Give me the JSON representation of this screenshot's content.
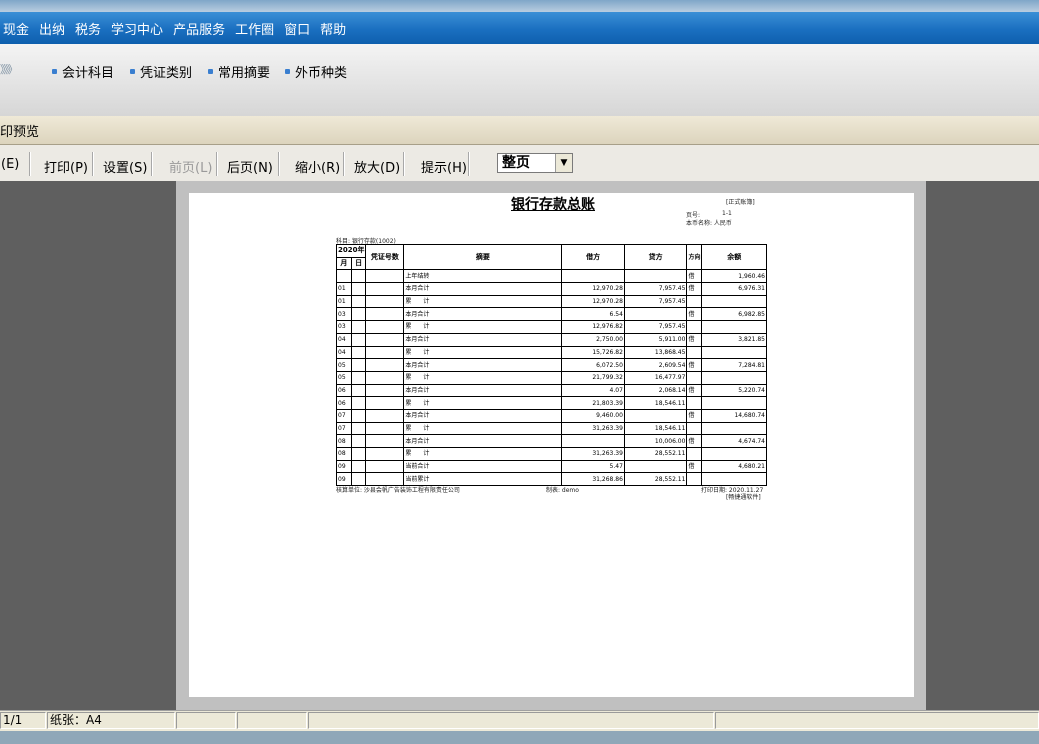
{
  "menu": [
    "现金",
    "出纳",
    "税务",
    "学习中心",
    "产品服务",
    "工作圈",
    "窗口",
    "帮助"
  ],
  "nav": {
    "chevron": "》》》",
    "links": [
      "会计科目",
      "凭证类别",
      "常用摘要",
      "外币种类"
    ]
  },
  "window_title": "印预览",
  "toolbar": {
    "edit": "(E)",
    "print": "打印(P)",
    "setup": "设置(S)",
    "prev": "前页(L)",
    "next": "后页(N)",
    "zoom_out": "缩小(R)",
    "zoom_in": "放大(D)",
    "hint": "提示(H)",
    "zoom_value": "整页"
  },
  "report": {
    "title": "银行存款总账",
    "tag": "[正式账簿]",
    "page_no_label": "页号:",
    "page_no": "1-1",
    "currency": "本币名称: 人民币",
    "subject": "科目: 银行存款(1002)",
    "headers": {
      "year": "2020年",
      "month": "月",
      "day": "日",
      "voucher": "凭证号数",
      "summary": "摘要",
      "debit": "借方",
      "credit": "贷方",
      "direction": "方向",
      "balance": "余额"
    },
    "rows": [
      {
        "m": "",
        "d": "",
        "v": "",
        "s": "上年结转",
        "dr": "",
        "cr": "",
        "dir": "借",
        "bal": "1,960.46"
      },
      {
        "m": "01",
        "d": "",
        "v": "",
        "s": "本月合计",
        "dr": "12,970.28",
        "cr": "7,957.45",
        "dir": "借",
        "bal": "6,976.31"
      },
      {
        "m": "01",
        "d": "",
        "v": "",
        "s": "累　　计",
        "dr": "12,970.28",
        "cr": "7,957.45",
        "dir": "",
        "bal": ""
      },
      {
        "m": "03",
        "d": "",
        "v": "",
        "s": "本月合计",
        "dr": "6.54",
        "cr": "",
        "dir": "借",
        "bal": "6,982.85"
      },
      {
        "m": "03",
        "d": "",
        "v": "",
        "s": "累　　计",
        "dr": "12,976.82",
        "cr": "7,957.45",
        "dir": "",
        "bal": ""
      },
      {
        "m": "04",
        "d": "",
        "v": "",
        "s": "本月合计",
        "dr": "2,750.00",
        "cr": "5,911.00",
        "dir": "借",
        "bal": "3,821.85"
      },
      {
        "m": "04",
        "d": "",
        "v": "",
        "s": "累　　计",
        "dr": "15,726.82",
        "cr": "13,868.45",
        "dir": "",
        "bal": ""
      },
      {
        "m": "05",
        "d": "",
        "v": "",
        "s": "本月合计",
        "dr": "6,072.50",
        "cr": "2,609.54",
        "dir": "借",
        "bal": "7,284.81"
      },
      {
        "m": "05",
        "d": "",
        "v": "",
        "s": "累　　计",
        "dr": "21,799.32",
        "cr": "16,477.97",
        "dir": "",
        "bal": ""
      },
      {
        "m": "06",
        "d": "",
        "v": "",
        "s": "本月合计",
        "dr": "4.07",
        "cr": "2,068.14",
        "dir": "借",
        "bal": "5,220.74"
      },
      {
        "m": "06",
        "d": "",
        "v": "",
        "s": "累　　计",
        "dr": "21,803.39",
        "cr": "18,546.11",
        "dir": "",
        "bal": ""
      },
      {
        "m": "07",
        "d": "",
        "v": "",
        "s": "本月合计",
        "dr": "9,460.00",
        "cr": "",
        "dir": "借",
        "bal": "14,680.74"
      },
      {
        "m": "07",
        "d": "",
        "v": "",
        "s": "累　　计",
        "dr": "31,263.39",
        "cr": "18,546.11",
        "dir": "",
        "bal": ""
      },
      {
        "m": "08",
        "d": "",
        "v": "",
        "s": "本月合计",
        "dr": "",
        "cr": "10,006.00",
        "dir": "借",
        "bal": "4,674.74"
      },
      {
        "m": "08",
        "d": "",
        "v": "",
        "s": "累　　计",
        "dr": "31,263.39",
        "cr": "28,552.11",
        "dir": "",
        "bal": ""
      },
      {
        "m": "09",
        "d": "",
        "v": "",
        "s": "当前合计",
        "dr": "5.47",
        "cr": "",
        "dir": "借",
        "bal": "4,680.21"
      },
      {
        "m": "09",
        "d": "",
        "v": "",
        "s": "当前累计",
        "dr": "31,268.86",
        "cr": "28,552.11",
        "dir": "",
        "bal": ""
      }
    ],
    "footer_unit": "核算单位: 沙县会帆广告装饰工程有限责任公司",
    "footer_maker": "制表: demo",
    "footer_date": "打印日期: 2020.11.27",
    "footer_brand": "[畅捷通软件]"
  },
  "status": {
    "page": "1/1",
    "paper": "纸张：A4"
  },
  "colors": {
    "menubar": "#1a6fc0",
    "page_bg": "#ffffff",
    "preview_bg": "#5f5f5f"
  }
}
